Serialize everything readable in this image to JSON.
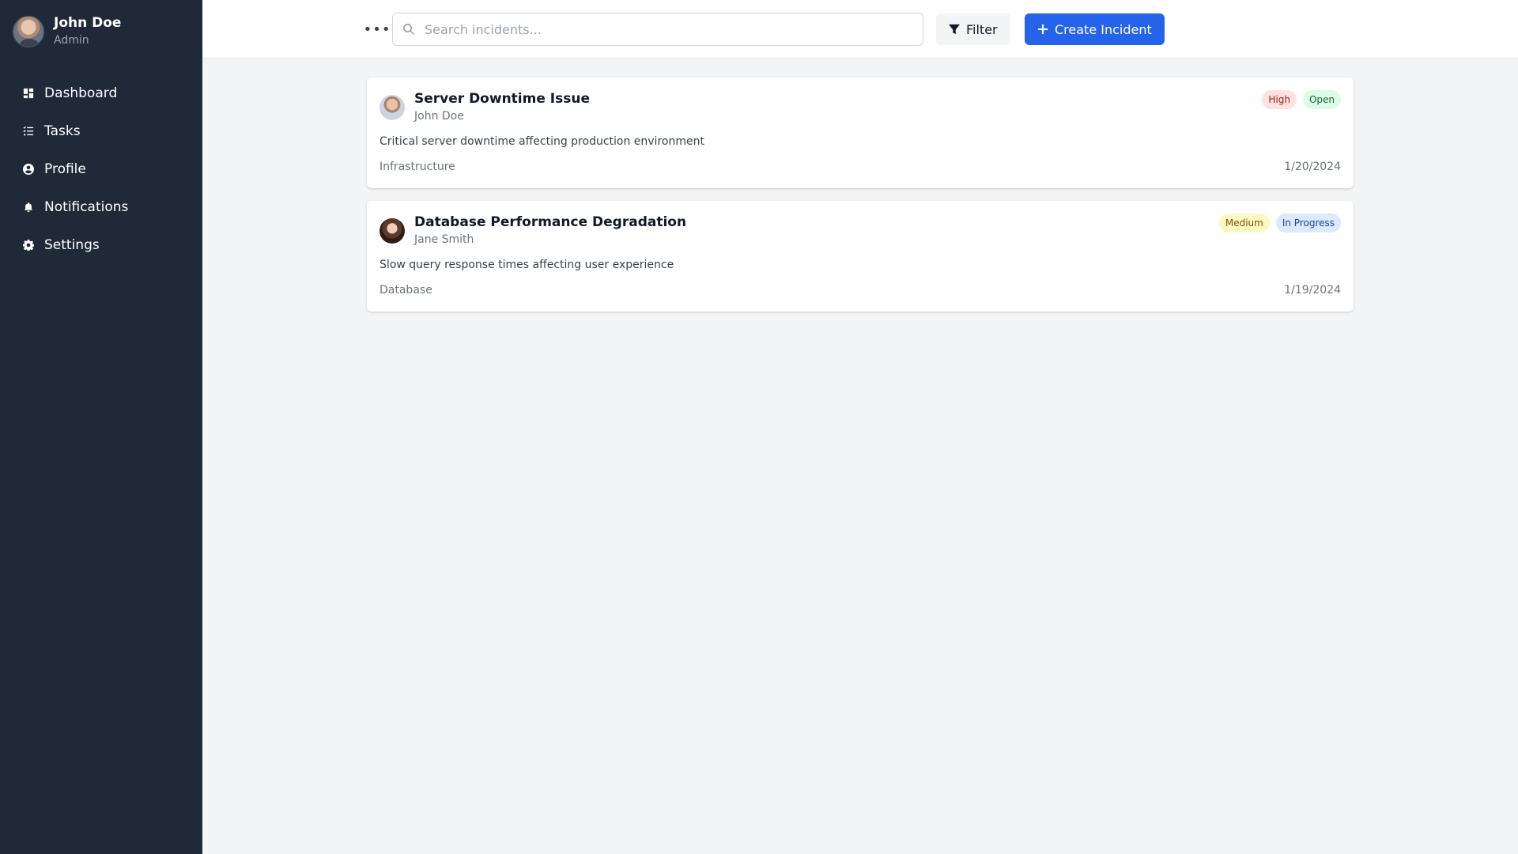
{
  "user": {
    "name": "John Doe",
    "role": "Admin"
  },
  "nav": [
    {
      "label": "Dashboard",
      "icon": "dashboard-icon"
    },
    {
      "label": "Tasks",
      "icon": "tasks-icon"
    },
    {
      "label": "Profile",
      "icon": "user-circle-icon"
    },
    {
      "label": "Notifications",
      "icon": "bell-icon"
    },
    {
      "label": "Settings",
      "icon": "gear-icon"
    }
  ],
  "toolbar": {
    "more_label": "•••",
    "search_placeholder": "Search incidents...",
    "filter_label": "Filter",
    "create_label": "Create Incident"
  },
  "colors": {
    "sidebar_bg": "#1f2937",
    "primary": "#2563eb",
    "high_bg": "#fee2e2",
    "high_fg": "#991b1b",
    "open_bg": "#dcfce7",
    "open_fg": "#166534",
    "medium_bg": "#fef9c3",
    "medium_fg": "#854d0e",
    "progress_bg": "#dbeafe",
    "progress_fg": "#1e40af"
  },
  "incidents": [
    {
      "title": "Server Downtime Issue",
      "author": "John Doe",
      "severity": "High",
      "status": "Open",
      "description": "Critical server downtime affecting production environment",
      "category": "Infrastructure",
      "date": "1/20/2024"
    },
    {
      "title": "Database Performance Degradation",
      "author": "Jane Smith",
      "severity": "Medium",
      "status": "In Progress",
      "description": "Slow query response times affecting user experience",
      "category": "Database",
      "date": "1/19/2024"
    }
  ]
}
